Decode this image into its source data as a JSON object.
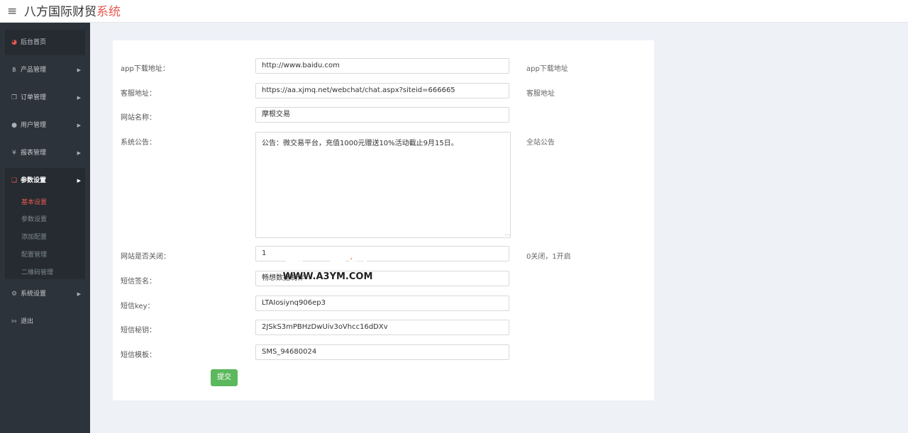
{
  "app": {
    "title_main": "八方国际财贸",
    "title_accent": "系统"
  },
  "sidebar": {
    "items": [
      {
        "label": "后台首页",
        "icon": "dashboard-icon"
      },
      {
        "label": "产品管理",
        "icon": "bitcoin-icon"
      },
      {
        "label": "订单管理",
        "icon": "copy-icon"
      },
      {
        "label": "用户管理",
        "icon": "user-icon"
      },
      {
        "label": "报表管理",
        "icon": "yen-icon"
      },
      {
        "label": "参数设置",
        "icon": "files-icon"
      },
      {
        "label": "系统设置",
        "icon": "gears-icon"
      },
      {
        "label": "退出",
        "icon": "sign-out-icon"
      }
    ],
    "submenu": [
      "基本设置",
      "参数设置",
      "添加配置",
      "配置管理",
      "二维码管理"
    ]
  },
  "form": {
    "fields": [
      {
        "label": "app下载地址：",
        "value": "http://www.baidu.com",
        "hint": "app下载地址"
      },
      {
        "label": "客服地址：",
        "value": "https://aa.xjmq.net/webchat/chat.aspx?siteid=666665",
        "hint": "客服地址"
      },
      {
        "label": "网站名称：",
        "value": "摩根交易",
        "hint": ""
      },
      {
        "label": "系统公告：",
        "value": "公告：微交易平台，充值1000元赠送10%活动截止9月15日。",
        "hint": "全站公告"
      },
      {
        "label": "网站是否关闭：",
        "value": "1",
        "hint": "0关闭，1开启"
      },
      {
        "label": "短信签名：",
        "value": "畅想数据制作",
        "hint": ""
      },
      {
        "label": "短信key：",
        "value": "LTAIosiynq906ep3",
        "hint": ""
      },
      {
        "label": "短信秘钥：",
        "value": "2JSkS3mPBHzDwUiv3oVhcc16dDXv",
        "hint": ""
      },
      {
        "label": "短信模板：",
        "value": "SMS_94680024",
        "hint": ""
      }
    ],
    "submit_label": "提交"
  },
  "watermark": {
    "line1": "阿三源码",
    "line2": "WWW.A3YM.COM"
  },
  "colors": {
    "accent": "#e85a4f",
    "sidebar_bg": "#2c333a",
    "submit_bg": "#5cb85c",
    "watermark": "#f07a1a"
  }
}
